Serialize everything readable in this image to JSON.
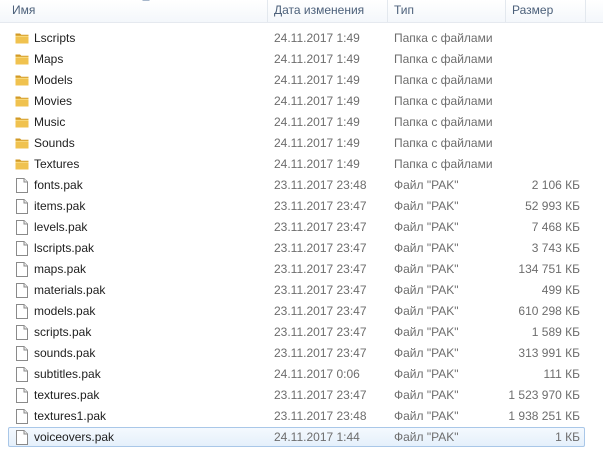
{
  "columns": {
    "name": "Имя",
    "date": "Дата изменения",
    "type": "Тип",
    "size": "Размер"
  },
  "rows": [
    {
      "name": "Lscripts",
      "date": "24.11.2017 1:49",
      "type": "Папка с файлами",
      "size": "",
      "icon": "folder-icon"
    },
    {
      "name": "Maps",
      "date": "24.11.2017 1:49",
      "type": "Папка с файлами",
      "size": "",
      "icon": "folder-icon"
    },
    {
      "name": "Models",
      "date": "24.11.2017 1:49",
      "type": "Папка с файлами",
      "size": "",
      "icon": "folder-icon"
    },
    {
      "name": "Movies",
      "date": "24.11.2017 1:49",
      "type": "Папка с файлами",
      "size": "",
      "icon": "folder-icon"
    },
    {
      "name": "Music",
      "date": "24.11.2017 1:49",
      "type": "Папка с файлами",
      "size": "",
      "icon": "folder-icon"
    },
    {
      "name": "Sounds",
      "date": "24.11.2017 1:49",
      "type": "Папка с файлами",
      "size": "",
      "icon": "folder-icon"
    },
    {
      "name": "Textures",
      "date": "24.11.2017 1:49",
      "type": "Папка с файлами",
      "size": "",
      "icon": "folder-icon"
    },
    {
      "name": "fonts.pak",
      "date": "23.11.2017 23:48",
      "type": "Файл \"PAK\"",
      "size": "2 106 КБ",
      "icon": "file-icon"
    },
    {
      "name": "items.pak",
      "date": "23.11.2017 23:47",
      "type": "Файл \"PAK\"",
      "size": "52 993 КБ",
      "icon": "file-icon"
    },
    {
      "name": "levels.pak",
      "date": "23.11.2017 23:47",
      "type": "Файл \"PAK\"",
      "size": "7 468 КБ",
      "icon": "file-icon"
    },
    {
      "name": "lscripts.pak",
      "date": "23.11.2017 23:47",
      "type": "Файл \"PAK\"",
      "size": "3 743 КБ",
      "icon": "file-icon"
    },
    {
      "name": "maps.pak",
      "date": "23.11.2017 23:47",
      "type": "Файл \"PAK\"",
      "size": "134 751 КБ",
      "icon": "file-icon"
    },
    {
      "name": "materials.pak",
      "date": "23.11.2017 23:47",
      "type": "Файл \"PAK\"",
      "size": "499 КБ",
      "icon": "file-icon"
    },
    {
      "name": "models.pak",
      "date": "23.11.2017 23:47",
      "type": "Файл \"PAK\"",
      "size": "610 298 КБ",
      "icon": "file-icon"
    },
    {
      "name": "scripts.pak",
      "date": "23.11.2017 23:47",
      "type": "Файл \"PAK\"",
      "size": "1 589 КБ",
      "icon": "file-icon"
    },
    {
      "name": "sounds.pak",
      "date": "23.11.2017 23:47",
      "type": "Файл \"PAK\"",
      "size": "313 991 КБ",
      "icon": "file-icon"
    },
    {
      "name": "subtitles.pak",
      "date": "24.11.2017 0:06",
      "type": "Файл \"PAK\"",
      "size": "111 КБ",
      "icon": "file-icon"
    },
    {
      "name": "textures.pak",
      "date": "23.11.2017 23:47",
      "type": "Файл \"PAK\"",
      "size": "1 523 970 КБ",
      "icon": "file-icon"
    },
    {
      "name": "textures1.pak",
      "date": "23.11.2017 23:48",
      "type": "Файл \"PAK\"",
      "size": "1 938 251 КБ",
      "icon": "file-icon"
    },
    {
      "name": "voiceovers.pak",
      "date": "24.11.2017 1:44",
      "type": "Файл \"PAK\"",
      "size": "1 КБ",
      "icon": "file-icon",
      "selected": true
    }
  ],
  "colors": {
    "folder": "#e8b84a",
    "folder_dark": "#d29a26",
    "selection_border": "#a9c7e8",
    "header_text": "#4c607a"
  }
}
